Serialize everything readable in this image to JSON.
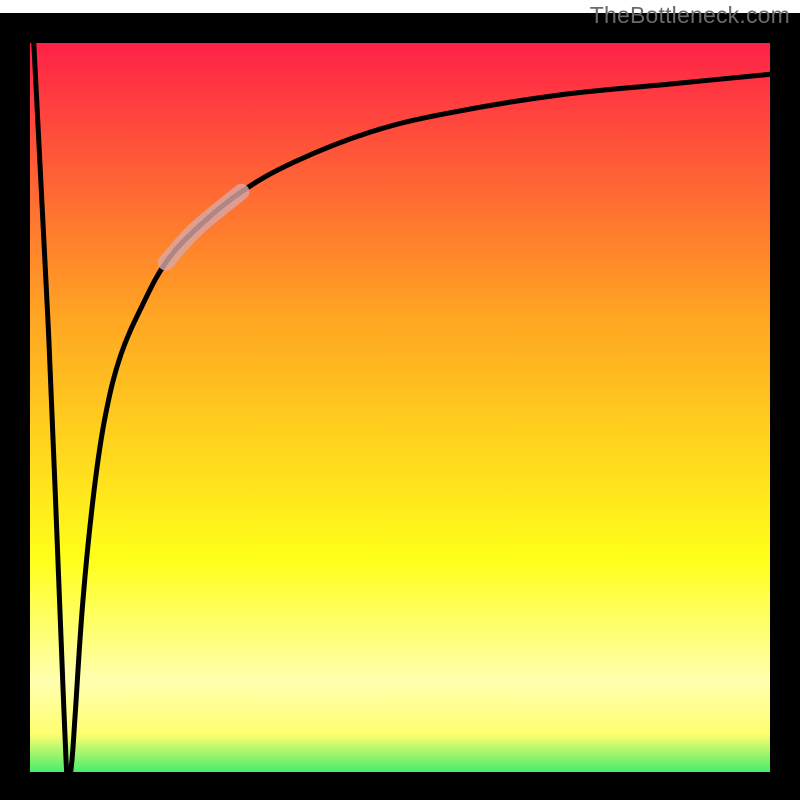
{
  "watermark": {
    "text": "TheBottleneck.com"
  },
  "colors": {
    "gradient_top": "#ff1a4a",
    "gradient_mid_orange": "#ffa522",
    "gradient_mid_yellow": "#ffff1a",
    "gradient_pale_band": "#ffffb0",
    "gradient_bottom": "#00e56a",
    "curve": "#000000",
    "curve_highlight": "#d8a7a7",
    "frame": "#000000"
  },
  "chart_data": {
    "type": "line",
    "title": "",
    "xlabel": "",
    "ylabel": "",
    "xlim": [
      0,
      100
    ],
    "ylim": [
      0,
      100
    ],
    "grid": false,
    "legend": false,
    "annotations": [
      {
        "text": "TheBottleneck.com",
        "position": "top-right"
      }
    ],
    "series": [
      {
        "name": "bottleneck-curve",
        "note": "Values expressed as percentages of the inner plot area. x left→right, y bottom→top. Curve plunges to ~0 near x≈5 then asymptotically rises toward y≈96.",
        "x": [
          0.5,
          2.5,
          4.5,
          5.0,
          5.5,
          6.0,
          7.0,
          8.5,
          10,
          12,
          15,
          18,
          22,
          28,
          35,
          45,
          55,
          70,
          85,
          100
        ],
        "values": [
          100,
          60,
          10,
          1,
          3,
          10,
          25,
          40,
          50,
          58,
          65,
          70.5,
          75,
          80,
          84,
          88,
          90.5,
          93,
          94.5,
          96
        ]
      }
    ],
    "highlight_segment": {
      "series": "bottleneck-curve",
      "x_start": 18,
      "x_end": 28
    },
    "background_gradient": {
      "direction": "vertical",
      "stops": [
        {
          "offset": 0.0,
          "color": "#ff1a4a"
        },
        {
          "offset": 0.38,
          "color": "#ffa522"
        },
        {
          "offset": 0.7,
          "color": "#ffff1a"
        },
        {
          "offset": 0.86,
          "color": "#ffffb0"
        },
        {
          "offset": 0.93,
          "color": "#ffff70"
        },
        {
          "offset": 1.0,
          "color": "#00e56a"
        }
      ]
    }
  }
}
